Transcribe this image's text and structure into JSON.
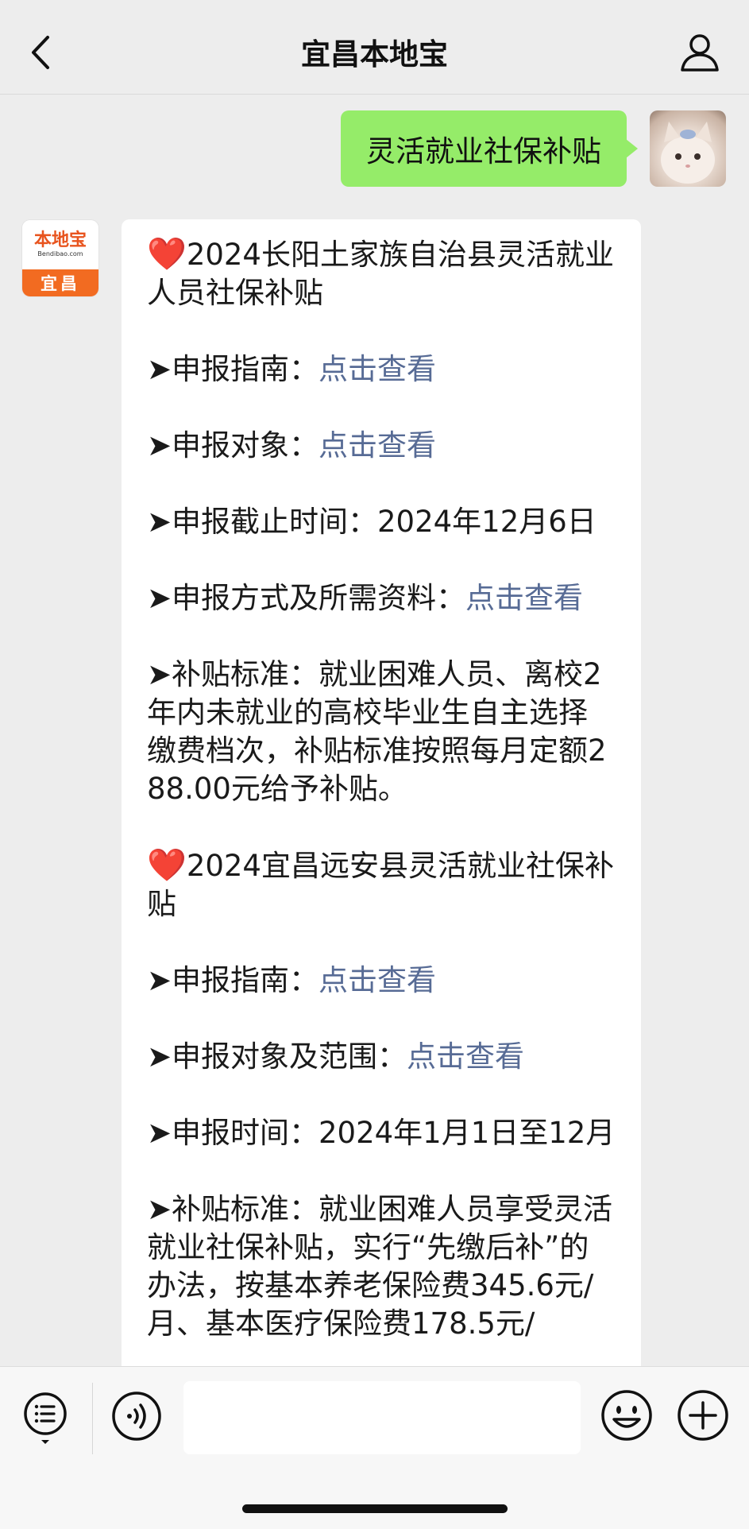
{
  "header": {
    "title": "宜昌本地宝",
    "back_icon": "chevron-left-icon",
    "profile_icon": "person-icon"
  },
  "outgoing": {
    "text": "灵活就业社保补贴"
  },
  "bot_avatar": {
    "logo_text": "本地宝",
    "logo_sub": "Bendibao.com",
    "city": "宜昌"
  },
  "message": {
    "heart": "❤️",
    "s1_title": "2024长阳土家族自治县灵活就业人员社保补贴",
    "s1_guide_label": "➤申报指南：",
    "s1_guide_link": "点击查看",
    "s1_target_label": "➤申报对象：",
    "s1_target_link": "点击查看",
    "s1_deadline": "➤申报截止时间：2024年12月6日",
    "s1_method_label": "➤申报方式及所需资料：",
    "s1_method_link": "点击查看",
    "s1_standard": "➤补贴标准：就业困难人员、离校2年内未就业的高校毕业生自主选择缴费档次，补贴标准按照每月定额288.00元给予补贴。",
    "s2_title": "2024宜昌远安县灵活就业社保补贴",
    "s2_guide_label": "➤申报指南：",
    "s2_guide_link": "点击查看",
    "s2_target_label": "➤申报对象及范围：",
    "s2_target_link": "点击查看",
    "s2_time": "➤申报时间：2024年1月1日至12月",
    "s2_standard": "➤补贴标准：就业困难人员享受灵活就业社保补贴，实行“先缴后补”的办法，按基本养老保险费345.6元/月、基本医疗保险费178.5元/"
  },
  "toolbar": {
    "menu_icon": "list-menu-icon",
    "voice_icon": "voice-icon",
    "emoji_icon": "emoji-icon",
    "plus_icon": "plus-icon",
    "input_value": ""
  }
}
